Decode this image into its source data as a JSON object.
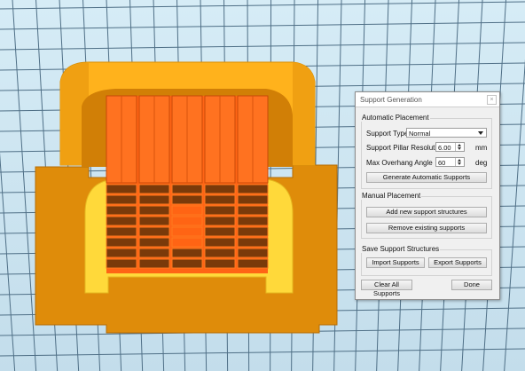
{
  "dialog": {
    "title": "Support Generation",
    "close_glyph": "×",
    "automatic": {
      "group_label": "Automatic Placement",
      "support_type_label": "Support Type",
      "support_type_value": "Normal",
      "pillar_resolution_label": "Support Pillar Resolution",
      "pillar_resolution_value": "6.00",
      "pillar_resolution_unit": "mm",
      "max_overhang_label": "Max Overhang Angle",
      "max_overhang_value": "60",
      "max_overhang_unit": "deg",
      "generate_button": "Generate Automatic Supports"
    },
    "manual": {
      "group_label": "Manual Placement",
      "add_button": "Add new support structures",
      "remove_button": "Remove existing supports"
    },
    "save": {
      "group_label": "Save Support Structures",
      "import_button": "Import Supports",
      "export_button": "Export Supports"
    },
    "clear_button": "Clear All Supports",
    "done_button": "Done"
  },
  "viewport": {
    "background_color": "#cfe6f2",
    "grid_color": "#4f6f86",
    "model_colors": {
      "dark_orange": "#e08e08",
      "light_orange": "#ffb41e",
      "yellow": "#ffdc3c",
      "red_orange": "#ff6414",
      "brown": "#7a3a0a"
    }
  }
}
